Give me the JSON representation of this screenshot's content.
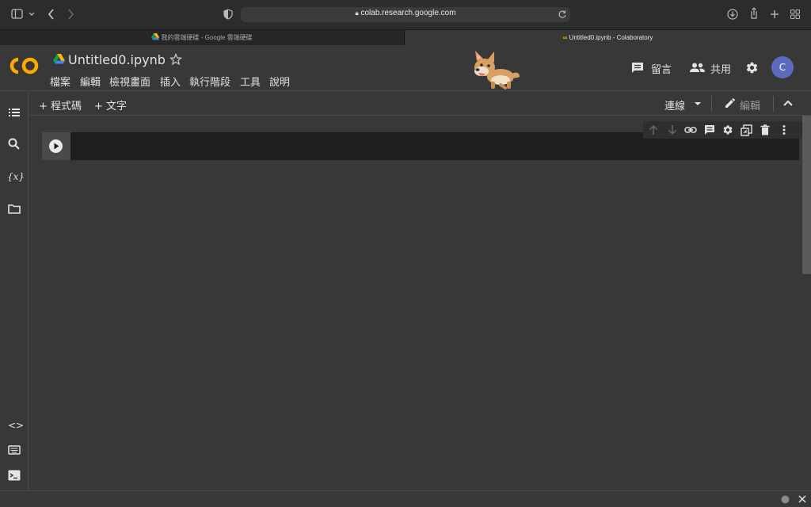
{
  "browser": {
    "url": "colab.research.google.com",
    "tabs": [
      {
        "label": "我的雲端硬碟 - Google 雲端硬碟"
      },
      {
        "label": "Untitled0.ipynb - Colaboratory"
      }
    ]
  },
  "header": {
    "logo": "CO",
    "notebook_title": "Untitled0.ipynb",
    "menu": [
      "檔案",
      "編輯",
      "檢視畫面",
      "插入",
      "執行階段",
      "工具",
      "說明"
    ],
    "comment_label": "留言",
    "share_label": "共用",
    "avatar_letter": "C"
  },
  "toolbar": {
    "add_code_label": "+ 程式碼",
    "add_text_label": "+ 文字",
    "connect_label": "連線",
    "edit_label": "編輯"
  },
  "colors": {
    "logo_orange": "#f9ab00",
    "avatar_bg": "#5c6bc0",
    "background": "#383838"
  }
}
